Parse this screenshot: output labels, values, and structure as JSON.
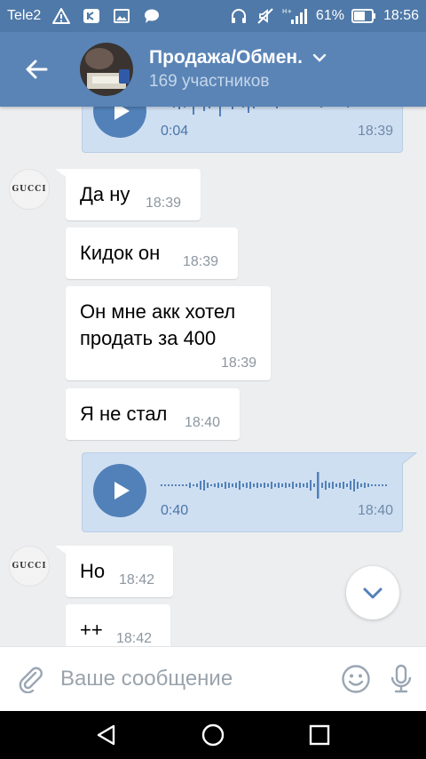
{
  "status_bar": {
    "carrier": "Tele2",
    "battery_percent": "61%",
    "time": "18:56",
    "network_label": "H+"
  },
  "header": {
    "title": "Продажа/Обмен.",
    "subtitle": "169 участников"
  },
  "messages": [
    {
      "type": "audio",
      "direction": "out",
      "duration": "0:04",
      "time": "18:39"
    },
    {
      "type": "text",
      "direction": "in",
      "text": "Да ну",
      "time": "18:39",
      "avatar_text": "GUCCI"
    },
    {
      "type": "text",
      "direction": "in",
      "text": "Кидок он",
      "time": "18:39"
    },
    {
      "type": "text",
      "direction": "in",
      "text_line1": "Он мне акк хотел",
      "text_line2": "продать за 400",
      "time": "18:39"
    },
    {
      "type": "text",
      "direction": "in",
      "text": "Я не стал",
      "time": "18:40"
    },
    {
      "type": "audio",
      "direction": "out",
      "duration": "0:40",
      "time": "18:40"
    },
    {
      "type": "text",
      "direction": "in",
      "text": "Но",
      "time": "18:42",
      "avatar_text": "GUCCI"
    },
    {
      "type": "text",
      "direction": "in",
      "text": "++",
      "time": "18:42"
    }
  ],
  "input": {
    "placeholder": "Ваше сообщение",
    "value": ""
  },
  "colors": {
    "header": "#5a84b6",
    "status_bar": "#4f79a8",
    "accent": "#5181b8",
    "outgoing_bubble": "#cfdff2",
    "background": "#edeef0"
  },
  "icons": {
    "back": "arrow-left-icon",
    "chevron": "chevron-down-icon",
    "attach": "paperclip-icon",
    "emoji": "smiley-icon",
    "mic": "microphone-icon",
    "scroll": "chevron-down-icon",
    "nav": [
      "back-triangle-icon",
      "home-circle-icon",
      "recents-square-icon"
    ]
  }
}
